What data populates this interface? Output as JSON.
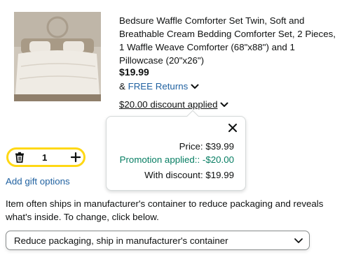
{
  "product": {
    "image_alt": "comforter-set-photo",
    "title": "Bedsure Waffle Comforter Set Twin, Soft and Breathable Cream Bedding Comforter Set, 2 Pieces, 1 Waffle Weave Comforter (68\"x88\") and 1 Pillowcase (20\"x26\")",
    "price": "$19.99",
    "returns_prefix": "& ",
    "returns_label": "FREE Returns",
    "discount_label": "$20.00 discount applied"
  },
  "popover": {
    "price_line": "Price: $39.99",
    "promotion_line": "Promotion applied:: -$20.00",
    "with_discount_line": "With discount: $19.99"
  },
  "quantity": {
    "value": "1"
  },
  "gift_options_label": "Add gift options",
  "packaging": {
    "note": "Item often ships in manufacturer's container to reduce packaging and reveals what's inside. To change, click below.",
    "selected_option": "Reduce packaging, ship in manufacturer's container"
  },
  "colors": {
    "link": "#2162a1",
    "promotion": "#067d62",
    "quantity_border": "#ffd814"
  }
}
